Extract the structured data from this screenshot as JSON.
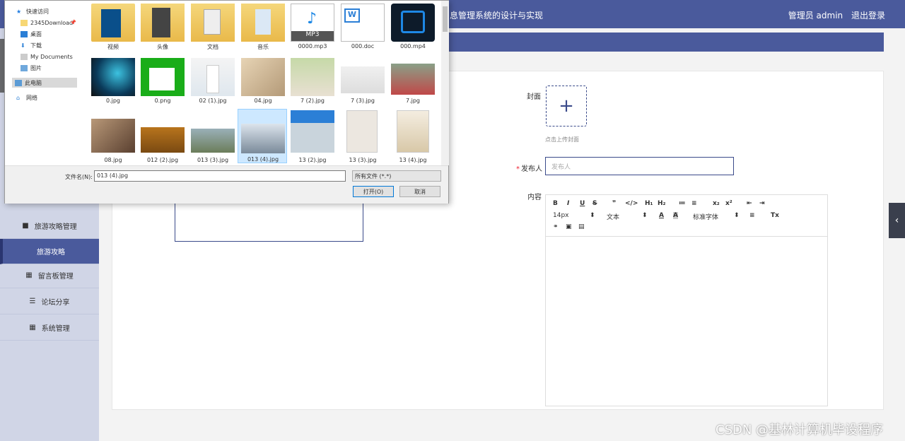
{
  "app": {
    "title": "息管理系统的设计与实现",
    "user_label": "管理员 admin",
    "logout_label": "退出登录"
  },
  "sidebar": {
    "items": [
      {
        "label": "旅游攻略管理",
        "icon": "clipboard-icon"
      },
      {
        "label": "旅游攻略",
        "active": true
      },
      {
        "label": "留言板管理",
        "icon": "grid-icon"
      },
      {
        "label": "论坛分享",
        "icon": "sliders-icon"
      },
      {
        "label": "系统管理",
        "icon": "grid-icon"
      }
    ]
  },
  "form": {
    "cover_label": "封面",
    "cover_hint": "点击上传封面",
    "publisher_label": "发布人",
    "publisher_placeholder": "发布人",
    "content_label": "内容",
    "editor": {
      "bold": "B",
      "italic": "I",
      "underline": "U",
      "strike": "S",
      "quote": "❞",
      "code": "</>",
      "h1": "H₁",
      "h2": "H₂",
      "ol": "≔",
      "ul": "≡",
      "sub": "x₂",
      "sup": "x²",
      "outdent": "⇤",
      "indent": "⇥",
      "size": "14px",
      "type": "文本",
      "color": "A",
      "bg": "A",
      "font": "标准字体",
      "align": "≡",
      "clear": "Tx"
    }
  },
  "dialog": {
    "nav": [
      {
        "label": "快速访问",
        "icon": "star-icon"
      },
      {
        "label": "2345Download",
        "icon": "folder-icon"
      },
      {
        "label": "桌面",
        "icon": "desktop-icon"
      },
      {
        "label": "下载",
        "icon": "download-icon"
      },
      {
        "label": "My Documents",
        "icon": "documents-icon"
      },
      {
        "label": "图片",
        "icon": "pictures-icon"
      },
      {
        "label": "此电脑",
        "icon": "computer-icon"
      },
      {
        "label": "网络",
        "icon": "network-icon"
      }
    ],
    "files": [
      {
        "name": "视频"
      },
      {
        "name": "头像"
      },
      {
        "name": "文档"
      },
      {
        "name": "音乐"
      },
      {
        "name": "0000.mp3"
      },
      {
        "name": "000.doc"
      },
      {
        "name": "000.mp4"
      },
      {
        "name": "0.jpg"
      },
      {
        "name": "0.png"
      },
      {
        "name": "02 (1).jpg"
      },
      {
        "name": "04.jpg"
      },
      {
        "name": "7 (2).jpg"
      },
      {
        "name": "7 (3).jpg"
      },
      {
        "name": "7.jpg"
      },
      {
        "name": "08.jpg"
      },
      {
        "name": "012 (2).jpg"
      },
      {
        "name": "013 (3).jpg"
      },
      {
        "name": "013 (4).jpg"
      },
      {
        "name": "13 (2).jpg"
      },
      {
        "name": "13 (3).jpg"
      },
      {
        "name": "13 (4).jpg"
      }
    ],
    "filename_label": "文件名(N):",
    "filename_value": "013 (4).jpg",
    "filetype_value": "所有文件 (*.*)",
    "open_label": "打开(O)",
    "cancel_label": "取消"
  },
  "watermark": "CSDN @基林计算机毕设程序"
}
